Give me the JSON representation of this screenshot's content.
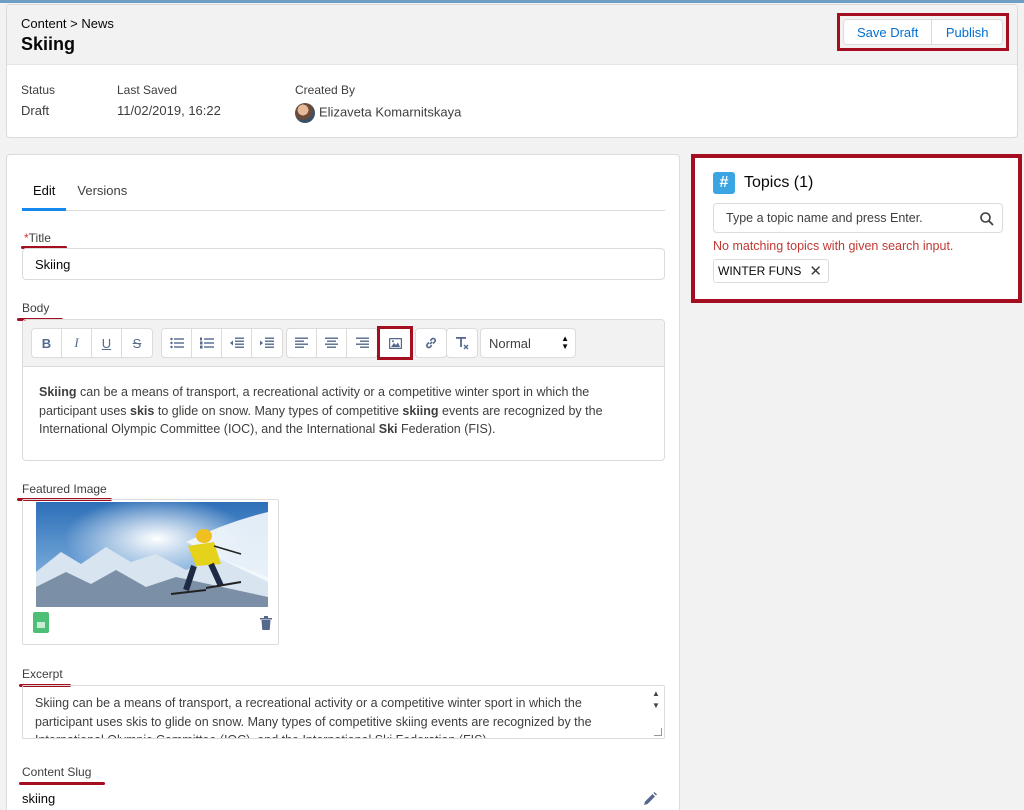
{
  "header": {
    "breadcrumb": "Content > News",
    "title": "Skiing",
    "actions": {
      "save_draft": "Save Draft",
      "publish": "Publish"
    },
    "meta": {
      "status_label": "Status",
      "status_value": "Draft",
      "saved_label": "Last Saved",
      "saved_value": "11/02/2019, 16:22",
      "created_label": "Created By",
      "created_value": "Elizaveta Komarnitskaya"
    }
  },
  "tabs": [
    {
      "label": "Edit",
      "active": true
    },
    {
      "label": "Versions",
      "active": false
    }
  ],
  "fields": {
    "title_label": "Title",
    "title_value": "Skiing",
    "body_label": "Body",
    "body_text": {
      "p1_b1": "Skiing",
      "p1_t1": " can be a means of transport, a recreational activity or a competitive winter sport in which the participant uses ",
      "p1_b2": "skis",
      "p1_t2": " to glide on snow. Many types of competitive ",
      "p1_b3": "skiing",
      "p1_t3": " events are recognized by the International Olympic Committee (IOC), and the International ",
      "p1_b4": "Ski",
      "p1_t4": " Federation (FIS)."
    },
    "format_value": "Normal",
    "featured_image_label": "Featured Image",
    "excerpt_label": "Excerpt",
    "excerpt_value": "Skiing can be a means of transport, a recreational activity or a competitive winter sport in which the participant uses skis to glide on snow. Many types of competitive skiing events are recognized by the International Olympic Committee (IOC), and the International Ski Federation (FIS).",
    "slug_label": "Content Slug",
    "slug_value": "skiing"
  },
  "toolbar": {
    "bold": "B",
    "italic": "I",
    "underline": "U",
    "strike": "S"
  },
  "topics": {
    "title": "Topics (1)",
    "placeholder": "Type a topic name and press Enter.",
    "error": "No matching topics with given search input.",
    "pills": [
      "WINTER FUNS"
    ]
  },
  "colors": {
    "accent": "#0070d2",
    "highlight": "#a50d21",
    "error": "#c23934",
    "topic_icon": "#3ba5e3"
  }
}
